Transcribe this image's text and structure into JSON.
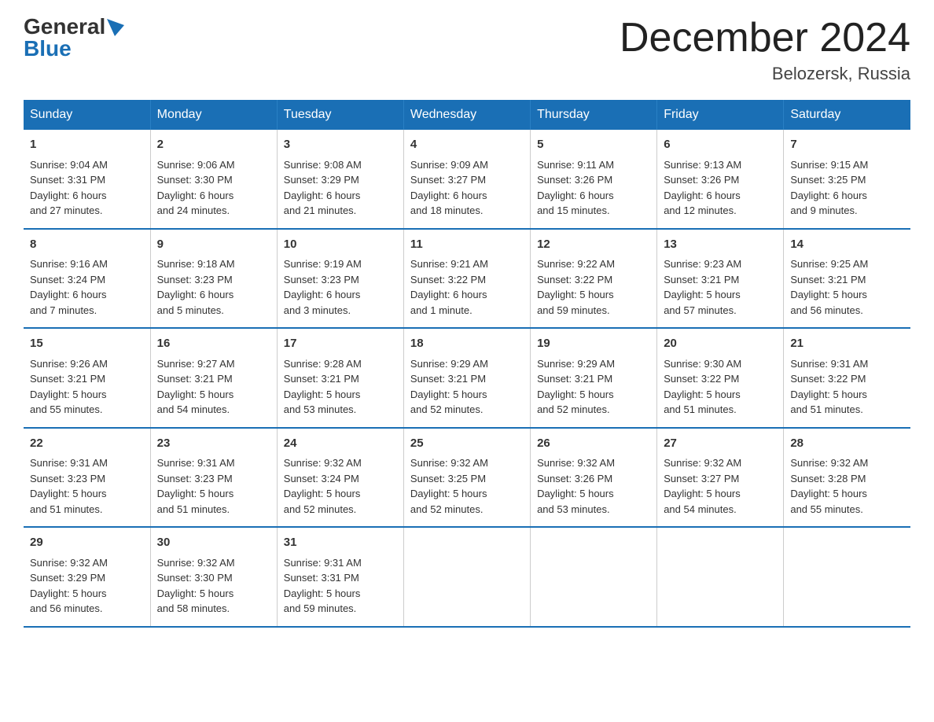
{
  "logo": {
    "general": "General",
    "blue": "Blue"
  },
  "title": "December 2024",
  "location": "Belozersk, Russia",
  "days_of_week": [
    "Sunday",
    "Monday",
    "Tuesday",
    "Wednesday",
    "Thursday",
    "Friday",
    "Saturday"
  ],
  "weeks": [
    [
      {
        "day": "1",
        "info": "Sunrise: 9:04 AM\nSunset: 3:31 PM\nDaylight: 6 hours\nand 27 minutes."
      },
      {
        "day": "2",
        "info": "Sunrise: 9:06 AM\nSunset: 3:30 PM\nDaylight: 6 hours\nand 24 minutes."
      },
      {
        "day": "3",
        "info": "Sunrise: 9:08 AM\nSunset: 3:29 PM\nDaylight: 6 hours\nand 21 minutes."
      },
      {
        "day": "4",
        "info": "Sunrise: 9:09 AM\nSunset: 3:27 PM\nDaylight: 6 hours\nand 18 minutes."
      },
      {
        "day": "5",
        "info": "Sunrise: 9:11 AM\nSunset: 3:26 PM\nDaylight: 6 hours\nand 15 minutes."
      },
      {
        "day": "6",
        "info": "Sunrise: 9:13 AM\nSunset: 3:26 PM\nDaylight: 6 hours\nand 12 minutes."
      },
      {
        "day": "7",
        "info": "Sunrise: 9:15 AM\nSunset: 3:25 PM\nDaylight: 6 hours\nand 9 minutes."
      }
    ],
    [
      {
        "day": "8",
        "info": "Sunrise: 9:16 AM\nSunset: 3:24 PM\nDaylight: 6 hours\nand 7 minutes."
      },
      {
        "day": "9",
        "info": "Sunrise: 9:18 AM\nSunset: 3:23 PM\nDaylight: 6 hours\nand 5 minutes."
      },
      {
        "day": "10",
        "info": "Sunrise: 9:19 AM\nSunset: 3:23 PM\nDaylight: 6 hours\nand 3 minutes."
      },
      {
        "day": "11",
        "info": "Sunrise: 9:21 AM\nSunset: 3:22 PM\nDaylight: 6 hours\nand 1 minute."
      },
      {
        "day": "12",
        "info": "Sunrise: 9:22 AM\nSunset: 3:22 PM\nDaylight: 5 hours\nand 59 minutes."
      },
      {
        "day": "13",
        "info": "Sunrise: 9:23 AM\nSunset: 3:21 PM\nDaylight: 5 hours\nand 57 minutes."
      },
      {
        "day": "14",
        "info": "Sunrise: 9:25 AM\nSunset: 3:21 PM\nDaylight: 5 hours\nand 56 minutes."
      }
    ],
    [
      {
        "day": "15",
        "info": "Sunrise: 9:26 AM\nSunset: 3:21 PM\nDaylight: 5 hours\nand 55 minutes."
      },
      {
        "day": "16",
        "info": "Sunrise: 9:27 AM\nSunset: 3:21 PM\nDaylight: 5 hours\nand 54 minutes."
      },
      {
        "day": "17",
        "info": "Sunrise: 9:28 AM\nSunset: 3:21 PM\nDaylight: 5 hours\nand 53 minutes."
      },
      {
        "day": "18",
        "info": "Sunrise: 9:29 AM\nSunset: 3:21 PM\nDaylight: 5 hours\nand 52 minutes."
      },
      {
        "day": "19",
        "info": "Sunrise: 9:29 AM\nSunset: 3:21 PM\nDaylight: 5 hours\nand 52 minutes."
      },
      {
        "day": "20",
        "info": "Sunrise: 9:30 AM\nSunset: 3:22 PM\nDaylight: 5 hours\nand 51 minutes."
      },
      {
        "day": "21",
        "info": "Sunrise: 9:31 AM\nSunset: 3:22 PM\nDaylight: 5 hours\nand 51 minutes."
      }
    ],
    [
      {
        "day": "22",
        "info": "Sunrise: 9:31 AM\nSunset: 3:23 PM\nDaylight: 5 hours\nand 51 minutes."
      },
      {
        "day": "23",
        "info": "Sunrise: 9:31 AM\nSunset: 3:23 PM\nDaylight: 5 hours\nand 51 minutes."
      },
      {
        "day": "24",
        "info": "Sunrise: 9:32 AM\nSunset: 3:24 PM\nDaylight: 5 hours\nand 52 minutes."
      },
      {
        "day": "25",
        "info": "Sunrise: 9:32 AM\nSunset: 3:25 PM\nDaylight: 5 hours\nand 52 minutes."
      },
      {
        "day": "26",
        "info": "Sunrise: 9:32 AM\nSunset: 3:26 PM\nDaylight: 5 hours\nand 53 minutes."
      },
      {
        "day": "27",
        "info": "Sunrise: 9:32 AM\nSunset: 3:27 PM\nDaylight: 5 hours\nand 54 minutes."
      },
      {
        "day": "28",
        "info": "Sunrise: 9:32 AM\nSunset: 3:28 PM\nDaylight: 5 hours\nand 55 minutes."
      }
    ],
    [
      {
        "day": "29",
        "info": "Sunrise: 9:32 AM\nSunset: 3:29 PM\nDaylight: 5 hours\nand 56 minutes."
      },
      {
        "day": "30",
        "info": "Sunrise: 9:32 AM\nSunset: 3:30 PM\nDaylight: 5 hours\nand 58 minutes."
      },
      {
        "day": "31",
        "info": "Sunrise: 9:31 AM\nSunset: 3:31 PM\nDaylight: 5 hours\nand 59 minutes."
      },
      {
        "day": "",
        "info": ""
      },
      {
        "day": "",
        "info": ""
      },
      {
        "day": "",
        "info": ""
      },
      {
        "day": "",
        "info": ""
      }
    ]
  ]
}
